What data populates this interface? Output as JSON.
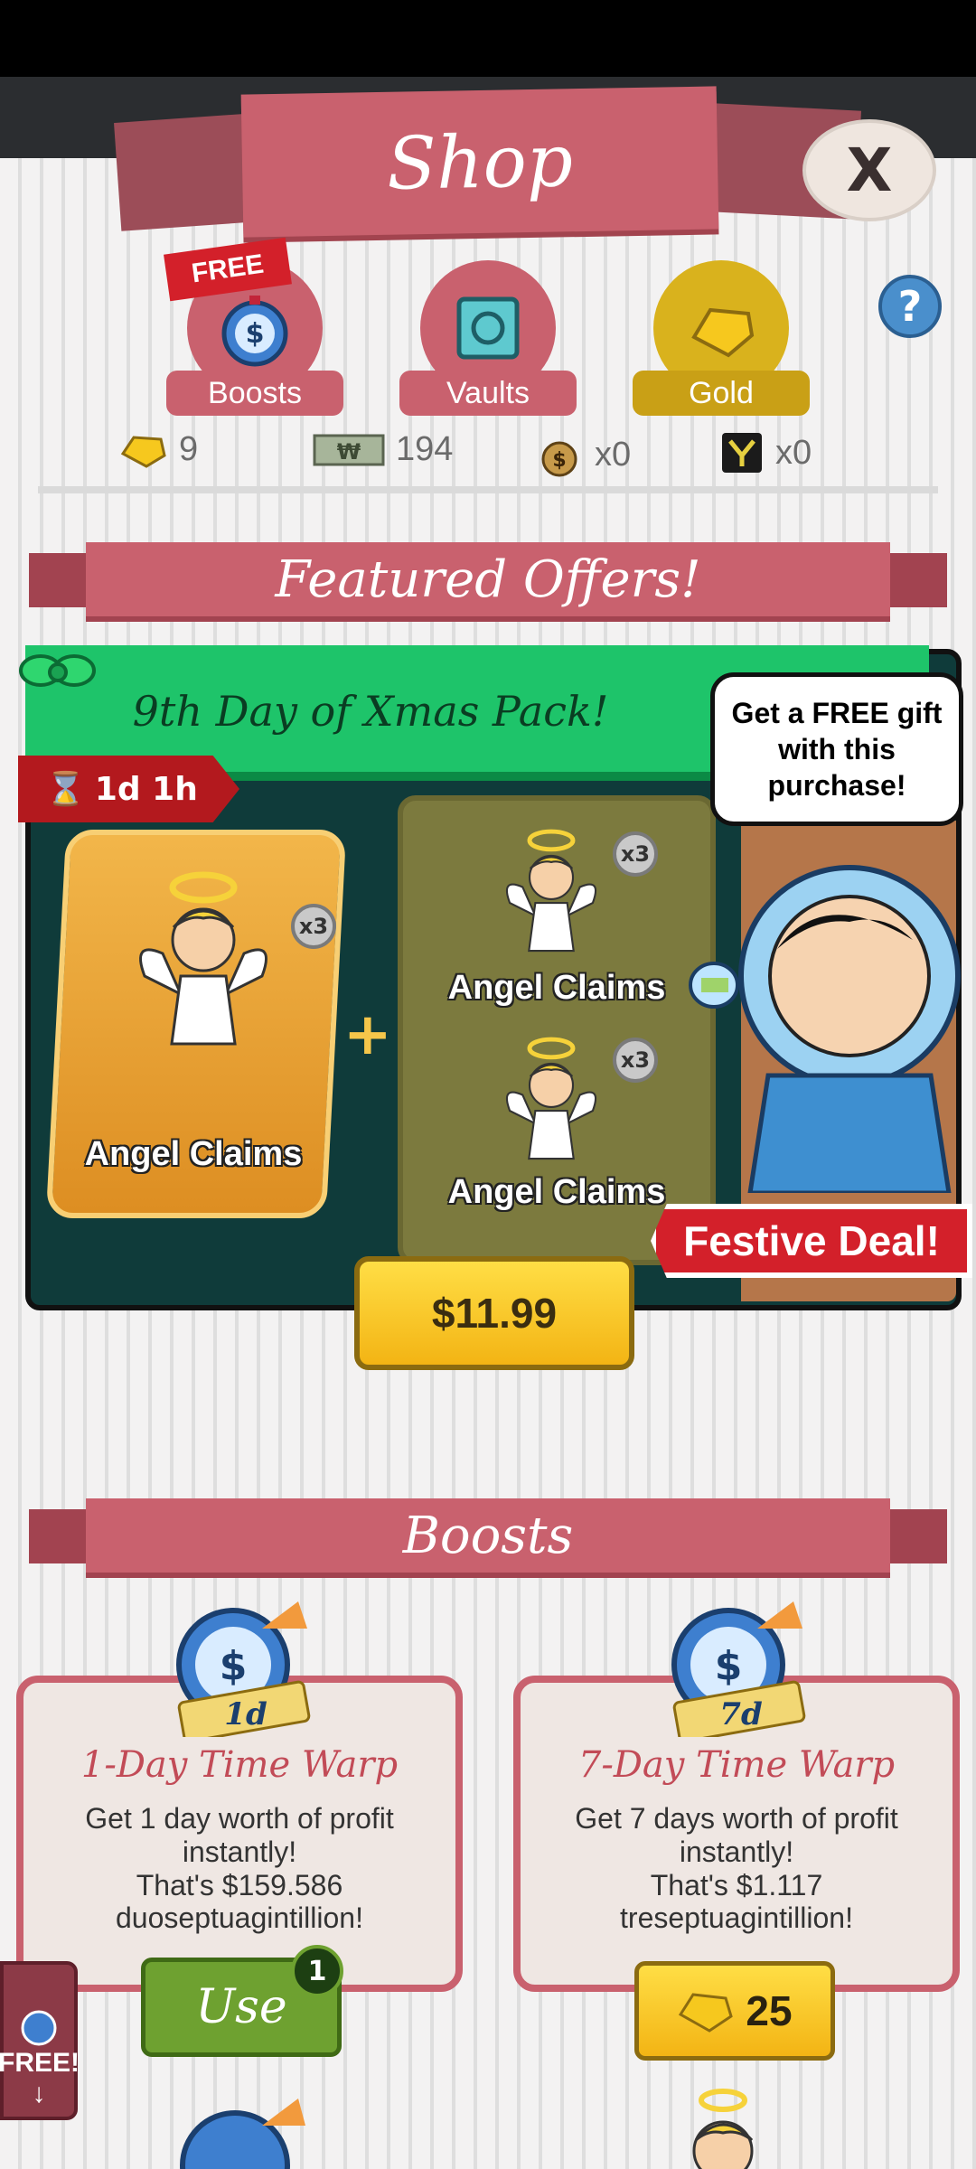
{
  "header": {
    "title": "Shop",
    "close_label": "X"
  },
  "categories": [
    {
      "label": "Boosts",
      "badge": "FREE"
    },
    {
      "label": "Vaults"
    },
    {
      "label": "Gold"
    }
  ],
  "help_label": "?",
  "currencies": {
    "gold": "9",
    "megabucks": "194",
    "cash_bags": "x0",
    "item_count": "x0"
  },
  "featured": {
    "section_title": "Featured Offers!",
    "pack_title": "9th Day of Xmas Pack!",
    "timer": "1d 1h",
    "speech": "Get a FREE gift with this purchase!",
    "main_item": {
      "label": "Angel Claims",
      "qty": "x3"
    },
    "extra_items": [
      {
        "label": "Angel Claims",
        "qty": "x3"
      },
      {
        "label": "Angel Claims",
        "qty": "x3"
      }
    ],
    "festive_label": "Festive Deal!",
    "price": "$11.99"
  },
  "boosts": {
    "section_title": "Boosts",
    "cards": [
      {
        "badge": "1d",
        "title": "1-Day Time Warp",
        "desc": [
          "Get 1 day worth of profit",
          "instantly!",
          "That's $159.586",
          "duoseptuagintillion!"
        ],
        "button": "Use",
        "count": "1"
      },
      {
        "badge": "7d",
        "title": "7-Day Time Warp",
        "desc": [
          "Get 7 days worth of profit",
          "instantly!",
          "That's $1.117",
          "treseptuagintillion!"
        ],
        "price": "25"
      }
    ]
  },
  "side_free": {
    "label": "FREE!",
    "arrow": "↓"
  },
  "colors": {
    "accent": "#c9616e",
    "gold": "#d9b21d",
    "green": "#1ec46a"
  }
}
